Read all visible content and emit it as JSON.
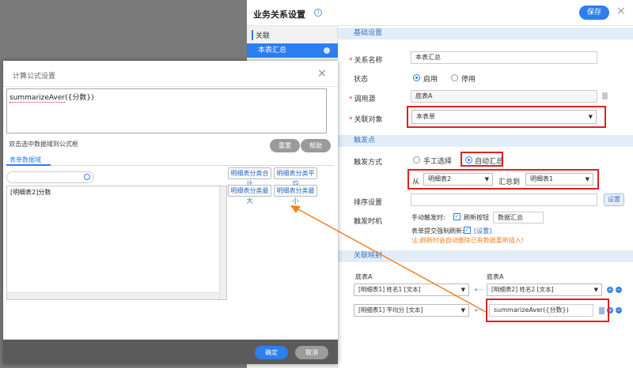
{
  "panel": {
    "title": "业务关系设置",
    "save": "保存",
    "close": "×",
    "nav_head": "关联",
    "nav_item": "本表汇总"
  },
  "basic": {
    "section": "基础设置",
    "name_label": "关系名称",
    "name_value": "本表汇总",
    "status_label": "状态",
    "status_on": "启用",
    "status_off": "停用",
    "source_label": "调用源",
    "source_value": "底表A",
    "target_label": "关联对象",
    "target_value": "本表单"
  },
  "trigger": {
    "section": "触发点",
    "mode_label": "触发方式",
    "mode_manual": "手工选择",
    "mode_auto": "自动汇总",
    "from_label": "从",
    "from_value": "明细表2",
    "to_label": "汇总到",
    "to_value": "明细表1",
    "sort_label": "排序设置",
    "sort_btn": "设置",
    "time_label": "触发时机",
    "manual_trigger": "手动触发时:",
    "refresh_btn_label": "刷新按钮",
    "data_summary": "数据汇总",
    "form_submit": "表单提交强制刷新:",
    "settings_link": "[设置]",
    "warning": "注:刷新时会自动删除已有数据重新插入!"
  },
  "mapping": {
    "section": "关联映射",
    "left_table": "底表A",
    "right_table": "底表A",
    "row1_left": "[明细表1] 姓名1 [文本]",
    "row1_right": "[明细表2] 姓名2 [文本]",
    "row2_left": "[明细表1] 平均分 [文本]",
    "row2_right": "summarizeAver({分数})"
  },
  "dialog": {
    "title": "计算公式设置",
    "close": "×",
    "formula_func": "summarizeAver",
    "formula_arg": "({分数})",
    "hint": "双击选中数据域到公式框",
    "reset": "重置",
    "help": "帮助",
    "tab": "表单数据域",
    "search_placeholder": "",
    "field_item": "[明细表2]分数",
    "fn_btns": [
      "明细表分类合计",
      "明细表分类平均",
      "明细表分类最大",
      "明细表分类最小"
    ],
    "ok": "确定",
    "cancel": "取消"
  },
  "colors": {
    "accent": "#2d7ef0",
    "highlight_box": "#e02020",
    "arrow": "#f58220"
  }
}
